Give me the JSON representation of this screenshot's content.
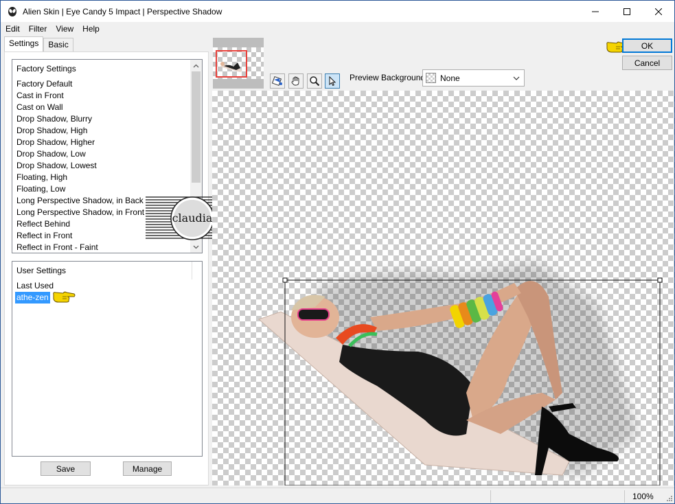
{
  "window": {
    "title": "Alien Skin | Eye Candy 5 Impact | Perspective Shadow",
    "controls": [
      "minimize-icon",
      "maximize-icon",
      "close-icon"
    ]
  },
  "menu": [
    "Edit",
    "Filter",
    "View",
    "Help"
  ],
  "tabs": [
    {
      "label": "Settings",
      "active": true
    },
    {
      "label": "Basic",
      "active": false
    }
  ],
  "factory_settings": {
    "heading": "Factory Settings",
    "items": [
      "Factory Default",
      "Cast in Front",
      "Cast on Wall",
      "Drop Shadow, Blurry",
      "Drop Shadow, High",
      "Drop Shadow, Higher",
      "Drop Shadow, Low",
      "Drop Shadow, Lowest",
      "Floating, High",
      "Floating, Low",
      "Long Perspective Shadow, in Back",
      "Long Perspective Shadow, in Front",
      "Reflect Behind",
      "Reflect in Front",
      "Reflect in Front - Faint"
    ]
  },
  "user_settings": {
    "heading": "User Settings",
    "items": [
      "Last Used",
      "athe-zen"
    ],
    "selected": "athe-zen"
  },
  "buttons": {
    "save": "Save",
    "manage": "Manage",
    "ok": "OK",
    "cancel": "Cancel"
  },
  "preview": {
    "background_label": "Preview Background:",
    "background_value": "None",
    "tools": [
      "bucket-icon",
      "hand-icon",
      "magnifier-icon",
      "arrow-pointer-icon"
    ],
    "active_tool": "arrow-pointer-icon"
  },
  "watermark": {
    "text": "claudia"
  },
  "status": {
    "zoom": "100%"
  },
  "colors": {
    "accent_blue": "#0078d7",
    "selection": "#3399ff",
    "pointer_yellow": "#f5d400"
  }
}
